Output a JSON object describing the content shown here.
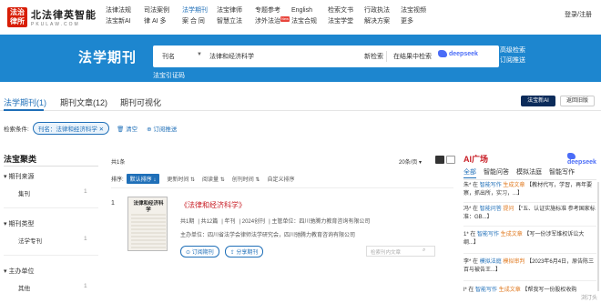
{
  "logo": {
    "badge": "法治\n律所",
    "title": "北法律英智能",
    "sub": "PKULAW.COM"
  },
  "nav": {
    "col1": [
      "法律法规",
      "法宝新AI"
    ],
    "col2": [
      "司法案例",
      "律 AI 多"
    ],
    "col3": [
      "法学期刊",
      "案 合 同"
    ],
    "col4": [
      "法宝律师",
      "智慧立法"
    ],
    "col5": [
      "专题参考",
      "涉外法治"
    ],
    "col6": [
      "English",
      "法宝合规"
    ],
    "col7": [
      "检索文书",
      "法宝学堂"
    ],
    "col8": [
      "行政执法",
      "解决方案"
    ],
    "col9": [
      "法宝视频",
      "更多"
    ]
  },
  "login": "登录/注册",
  "banner": {
    "title": "法学期刊",
    "field": "刊名",
    "query": "法律和经济科学",
    "btn_new": "新检索",
    "btn_within": "在结果中检索",
    "deepseek": "deepseek",
    "adv": "高级检索",
    "subscribe": "订阅推送",
    "cert": "法宝引证码"
  },
  "tabs": {
    "t1": "法学期刊(1)",
    "t2": "期刊文章(12)",
    "t3": "期刊可视化",
    "ai_btn": "法宝新AI",
    "back": "返回旧版"
  },
  "filter": {
    "label": "检索条件:",
    "chip": "刊名：法律和经济科学",
    "clear": "清空",
    "subscribe": "订阅推送"
  },
  "left": {
    "title": "法宝聚类",
    "sections": [
      {
        "name": "▾ 期刊来源",
        "item": "集刊",
        "count": "1"
      },
      {
        "name": "▾ 期刊类型",
        "item": "法学专刊",
        "count": "1"
      },
      {
        "name": "▾ 主办单位",
        "item": "其他",
        "count": "1"
      }
    ]
  },
  "center": {
    "total": "共1条",
    "perpage": "20条/页 ▾",
    "sort_label": "排序:",
    "sort": [
      "默认排序 ↓",
      "更新时间 ⇅",
      "阅读量 ⇅",
      "创刊时间 ⇅",
      "自定义排序"
    ],
    "result": {
      "num": "1",
      "cover_title": "法律和经济科学",
      "title": "《法律和经济科学》",
      "meta": [
        "共1期",
        "共12篇",
        "年刊",
        "2024创刊",
        "主管单位：四川驰腾力教育咨询有限公司"
      ],
      "author": "主办单位：四川省法学会律师法学研究会，四川驰腾力教育咨询有限公司",
      "btn1": "订阅期刊",
      "btn2": "分享期刊",
      "search_ph": "检索刊内文章"
    }
  },
  "ai": {
    "title": "AI广场",
    "deepseek": "deepseek",
    "tabs": [
      "全部",
      "智能问答",
      "模拟法庭",
      "智能写作"
    ],
    "items": [
      {
        "a": "朱*",
        "b": "在",
        "c": "智能写作",
        "d": "生成文章",
        "e": "【教材代写，学習，再年要察，抓出所，实习，...】"
      },
      {
        "a": "冯*",
        "b": "在",
        "c": "智能问答",
        "d": "提问",
        "e": "【“五、认证实施标准 参考国家标准：GB...】"
      },
      {
        "a": "1*",
        "b": "在",
        "c": "智能写作",
        "d": "生成文章",
        "e": "【写一份涉军维权诉讼大纲...】"
      },
      {
        "a": "李*",
        "b": "在",
        "c": "模拟法庭",
        "d": "模拟审判",
        "e": "【2023年6月4日，原告陈三百与被告王...】"
      },
      {
        "a": "l*",
        "b": "在",
        "c": "智能写作",
        "d": "生成文章",
        "e": "【帮我写一份股权收购"
      }
    ]
  },
  "corner": "浏汀头"
}
